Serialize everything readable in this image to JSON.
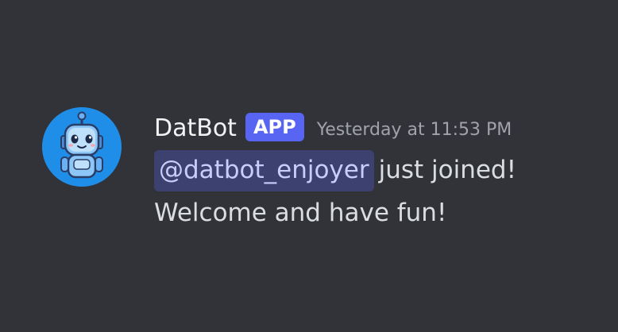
{
  "message": {
    "author": "DatBot",
    "badge": "APP",
    "timestamp": "Yesterday at 11:53 PM",
    "mention": "@datbot_enjoyer",
    "line1_rest": "just joined!",
    "line2": "Welcome and have fun!",
    "avatar_icon": "robot-avatar"
  },
  "colors": {
    "background": "#323339",
    "avatar_bg": "#1f8ee9",
    "app_badge": "#5865f2",
    "mention_bg": "#3c4170",
    "mention_text": "#c9cdfb",
    "timestamp": "#a1a3ab"
  }
}
